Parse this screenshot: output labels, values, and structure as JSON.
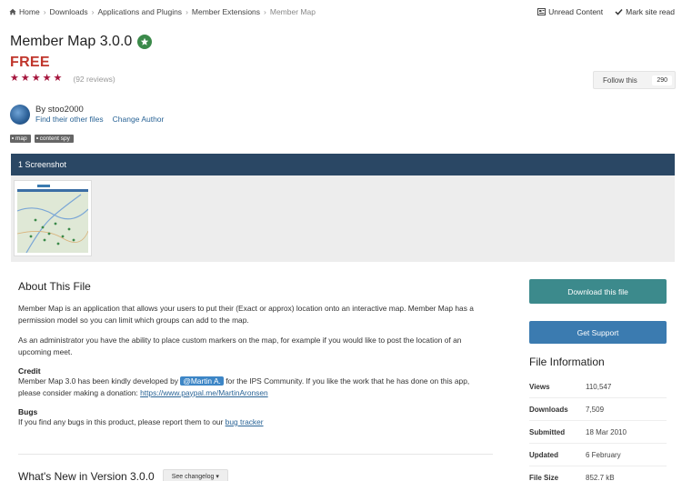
{
  "breadcrumb": {
    "items": [
      "Home",
      "Downloads",
      "Applications and Plugins",
      "Member Extensions"
    ],
    "current": "Member Map"
  },
  "topbar": {
    "unread": "Unread Content",
    "mark_read": "Mark site read"
  },
  "file": {
    "title": "Member Map 3.0.0",
    "price": "FREE",
    "rating_stars": 5,
    "reviews": "(92 reviews)"
  },
  "follow": {
    "label": "Follow this",
    "count": "290"
  },
  "author": {
    "by": "By stoo2000",
    "other_files": "Find their other files",
    "change_author": "Change Author"
  },
  "tags": [
    "map",
    "content spy"
  ],
  "screenshots": {
    "header": "1 Screenshot"
  },
  "about": {
    "heading": "About This File",
    "p1": "Member Map is an application that allows your users to put their (Exact or approx) location onto an interactive map. Member Map has a permission model so you can limit which groups can add to the map.",
    "p2": "As an administrator you have the ability to place custom markers on the map, for example if you would like to post the location of an upcoming meet.",
    "credit_heading": "Credit",
    "credit_pre": "Member Map 3.0 has been kindly developed by",
    "credit_mention": "@Martin A.",
    "credit_post": "for the IPS Community. If you like the work that he has done on this app, please consider making a donation:",
    "credit_link": "https://www.paypal.me/MartinAronsen",
    "bugs_heading": "Bugs",
    "bugs_pre": "If you find any bugs in this product, please report them to our",
    "bugs_link": "bug tracker"
  },
  "whatsnew": {
    "heading": "What's New in Version 3.0.0",
    "see_changelog": "See changelog"
  },
  "sidebar": {
    "download": "Download this file",
    "support": "Get Support",
    "info_heading": "File Information",
    "info": [
      {
        "label": "Views",
        "value": "110,547"
      },
      {
        "label": "Downloads",
        "value": "7,509"
      },
      {
        "label": "Submitted",
        "value": "18 Mar 2010"
      },
      {
        "label": "Updated",
        "value": "6 February"
      },
      {
        "label": "File Size",
        "value": "852.7 kB"
      }
    ]
  },
  "colors": {
    "price": "#c0362c",
    "star": "#a5143c",
    "screenshot_header": "#2a4764",
    "download_button": "#3c8a8c",
    "support_button": "#3b7bb0",
    "mention": "#3d86c6",
    "badge": "#3b8a4a"
  }
}
